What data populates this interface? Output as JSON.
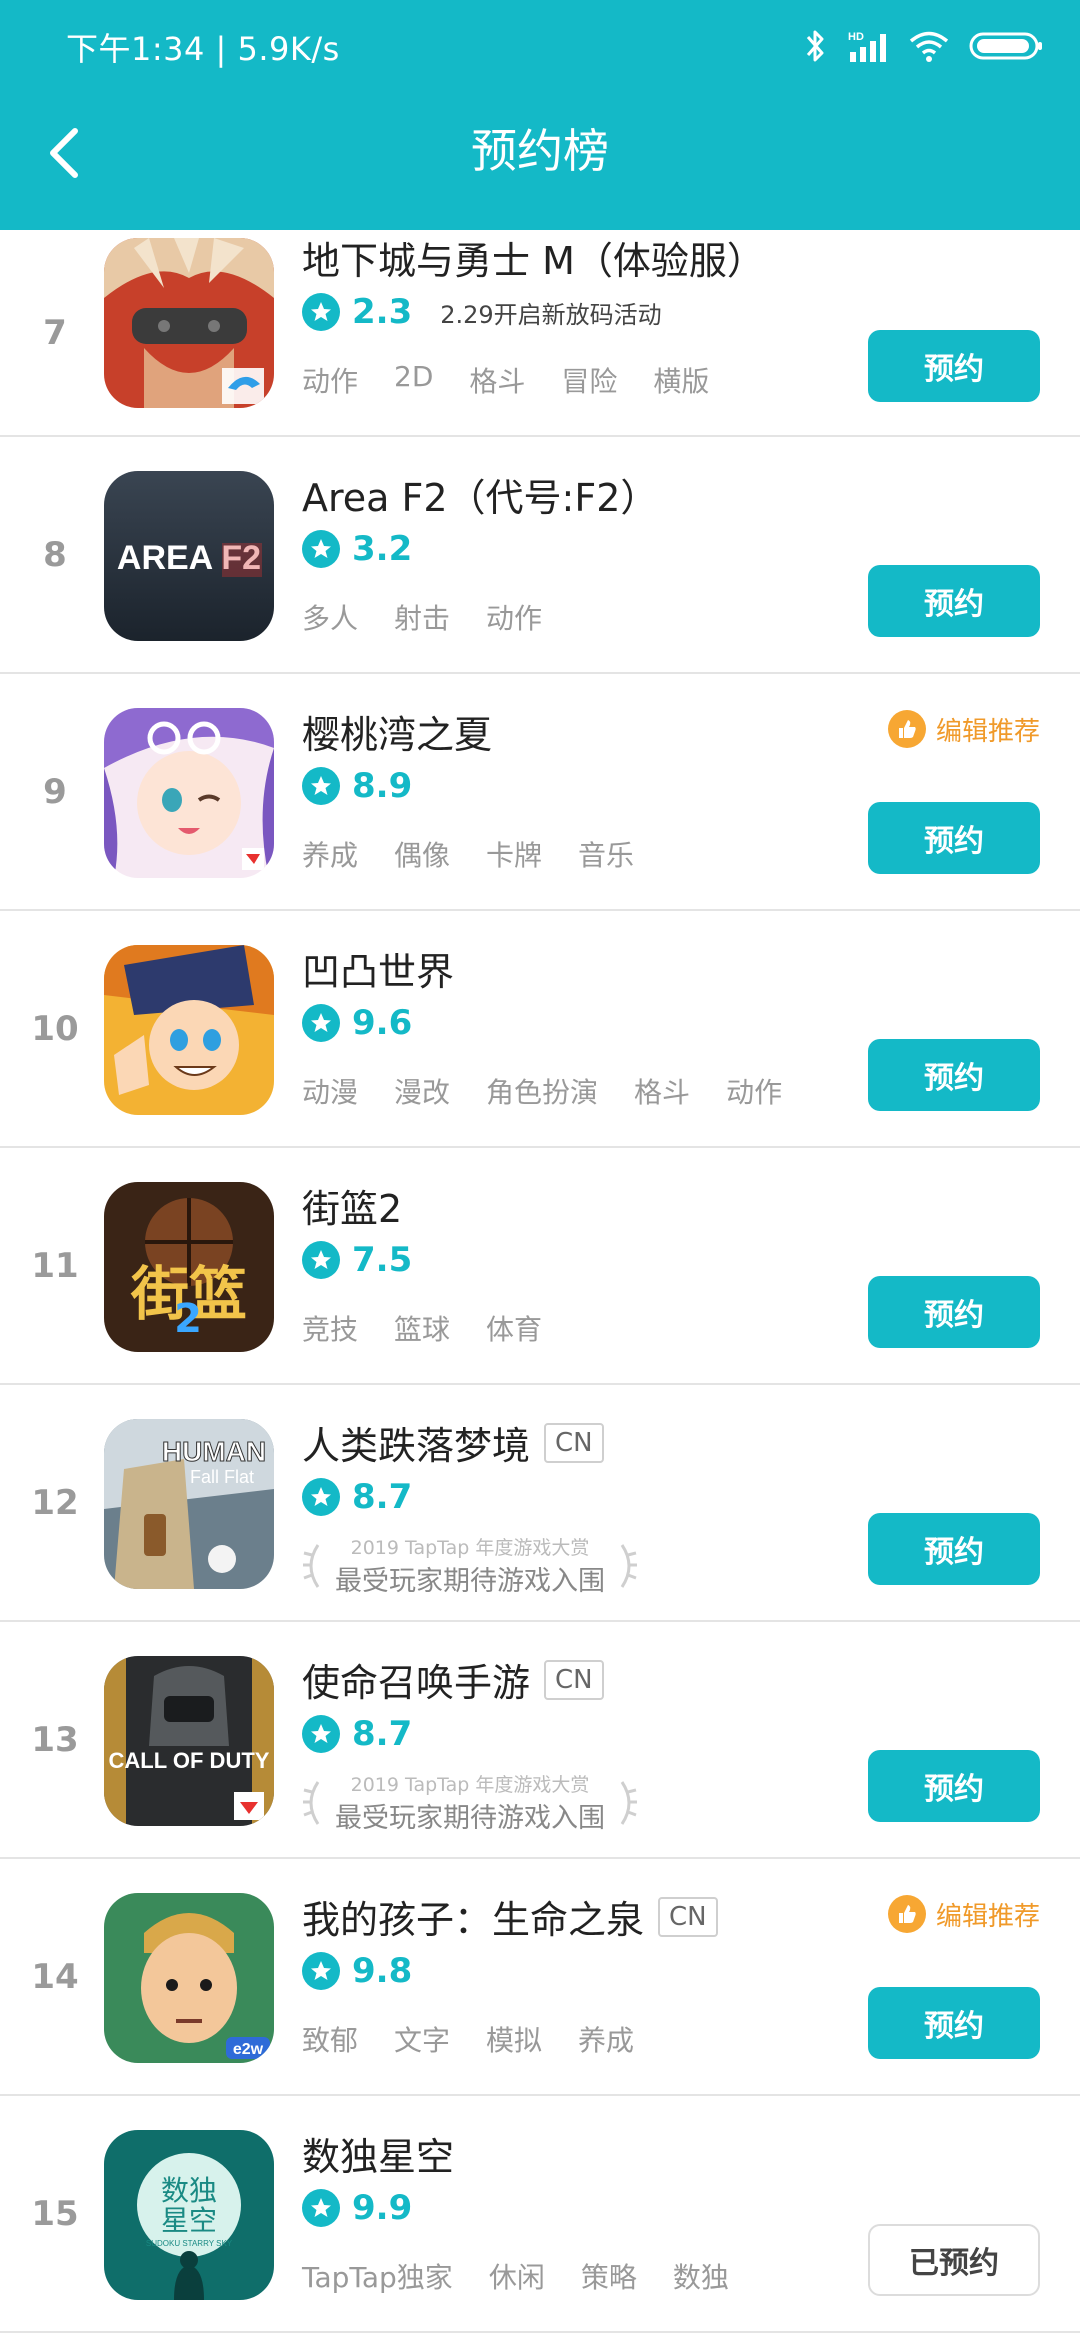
{
  "status_bar": {
    "time": "下午1:34 | 5.9K/s",
    "network_label": "HD"
  },
  "header": {
    "title": "预约榜",
    "back_icon": "chevron-left-icon"
  },
  "colors": {
    "accent": "#14b9c7",
    "editor": "#f7a733"
  },
  "award_text": {
    "sub": "2019 TapTap 年度游戏大赏",
    "main": "最受玩家期待游戏入围"
  },
  "editor_pick_label": "编辑推荐",
  "games": [
    {
      "rank": "7",
      "title": "地下城与勇士 M（体验服）",
      "rating": "2.3",
      "promo": "2.29开启新放码活动",
      "tags": [
        "动作",
        "2D",
        "格斗",
        "冒险",
        "横版"
      ],
      "button": "预约"
    },
    {
      "rank": "8",
      "title": "Area F2（代号:F2）",
      "rating": "3.2",
      "tags": [
        "多人",
        "射击",
        "动作"
      ],
      "button": "预约"
    },
    {
      "rank": "9",
      "title": "樱桃湾之夏",
      "rating": "8.9",
      "tags": [
        "养成",
        "偶像",
        "卡牌",
        "音乐"
      ],
      "button": "预约"
    },
    {
      "rank": "10",
      "title": "凹凸世界",
      "rating": "9.6",
      "tags": [
        "动漫",
        "漫改",
        "角色扮演",
        "格斗",
        "动作"
      ],
      "button": "预约"
    },
    {
      "rank": "11",
      "title": "街篮2",
      "rating": "7.5",
      "tags": [
        "竞技",
        "篮球",
        "体育"
      ],
      "button": "预约"
    },
    {
      "rank": "12",
      "title": "人类跌落梦境",
      "badge": "CN",
      "rating": "8.7",
      "button": "预约"
    },
    {
      "rank": "13",
      "title": "使命召唤手游",
      "badge": "CN",
      "rating": "8.7",
      "button": "预约"
    },
    {
      "rank": "14",
      "title": "我的孩子：生命之泉",
      "badge": "CN",
      "rating": "9.8",
      "tags": [
        "致郁",
        "文字",
        "模拟",
        "养成"
      ],
      "button": "预约"
    },
    {
      "rank": "15",
      "title": "数独星空",
      "rating": "9.9",
      "tags": [
        "TapTap独家",
        "休闲",
        "策略",
        "数独"
      ],
      "button": "已预约"
    }
  ],
  "icon_art": {
    "area_f2": "AREA F2",
    "human_line1": "HUMAN",
    "human_line2": "Fall Flat",
    "cod": "CALL OF DUTY",
    "street": "街篮",
    "street_num": "2",
    "sudoku_cn1": "数独",
    "sudoku_cn2": "星空",
    "sudoku_en": "SUDOKU STARRY SKY",
    "mychild_badge": "e2w"
  }
}
